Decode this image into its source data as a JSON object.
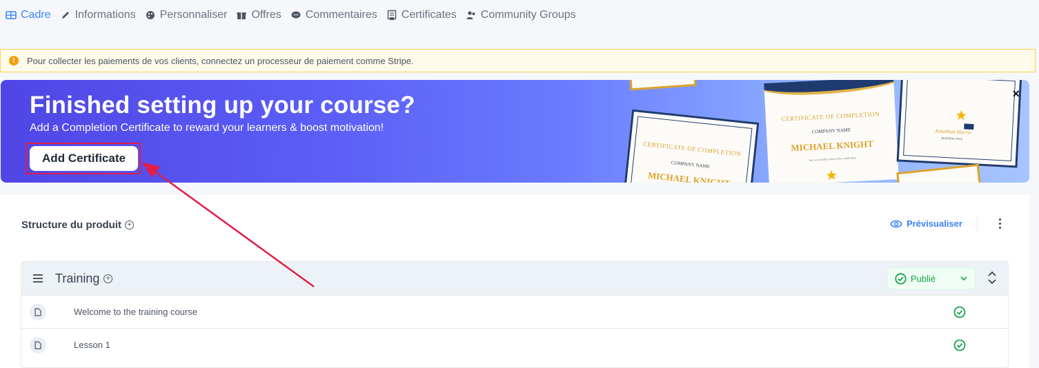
{
  "tabs": [
    {
      "label": "Cadre",
      "icon": "layout-icon",
      "active": true
    },
    {
      "label": "Informations",
      "icon": "pencil-icon",
      "active": false
    },
    {
      "label": "Personnaliser",
      "icon": "palette-icon",
      "active": false
    },
    {
      "label": "Offres",
      "icon": "gift-icon",
      "active": false
    },
    {
      "label": "Commentaires",
      "icon": "comment-icon",
      "active": false
    },
    {
      "label": "Certificates",
      "icon": "certificate-icon",
      "active": false
    },
    {
      "label": "Community Groups",
      "icon": "users-icon",
      "active": false
    }
  ],
  "warning": {
    "text": "Pour collecter les paiements de vos clients, connectez un processeur de paiement comme Stripe.",
    "icon": "info-icon",
    "color": "#f59e0b"
  },
  "banner": {
    "title": "Finished setting up your course?",
    "subtitle": "Add a Completion Certificate to reward your learners & boost motivation!",
    "button_label": "Add Certificate",
    "close_label": "×",
    "certificates": [
      {
        "title": "CERTIFICATE OF COMPLETION",
        "company": "COMPANY NAME",
        "name": "MICHAEL KNIGHT"
      },
      {
        "title": "CERTIFICATE OF COMPLETION",
        "company": "COMPANY NAME",
        "name": "MICHAEL KNIGHT",
        "note": "has successfully achieved this certification"
      },
      {
        "signature": "Jonathan Harris",
        "role": "BUSINESS TITLE"
      }
    ]
  },
  "product": {
    "structure_title": "Structure du produit",
    "preview_label": "Prévisualiser",
    "module": {
      "title": "Training",
      "status": "Publié",
      "lessons": [
        {
          "title": "Welcome to the training course",
          "completed": true
        },
        {
          "title": "Lesson 1",
          "completed": true
        }
      ]
    }
  },
  "colors": {
    "accent": "#3b82f6",
    "published": "#16a34a",
    "annotation": "#e11d48"
  }
}
